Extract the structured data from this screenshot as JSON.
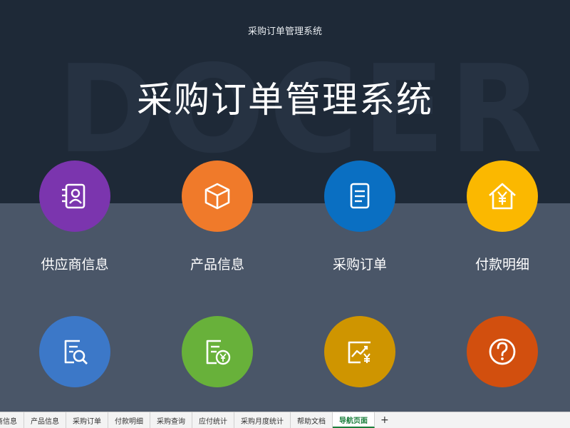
{
  "header": {
    "small_title": "采购订单管理系统",
    "title": "采购订单管理系统",
    "watermark": "DOCER"
  },
  "nav_items": [
    {
      "label": "供应商信息",
      "icon": "contact-card-icon",
      "color": "#7b35ae"
    },
    {
      "label": "产品信息",
      "icon": "box-icon",
      "color": "#f07a2a"
    },
    {
      "label": "采购订单",
      "icon": "document-icon",
      "color": "#0a6fc2"
    },
    {
      "label": "付款明细",
      "icon": "house-yen-icon",
      "color": "#fbb800"
    },
    {
      "label": "",
      "icon": "search-document-icon",
      "color": "#3c78c8"
    },
    {
      "label": "",
      "icon": "yen-document-icon",
      "color": "#68b13a"
    },
    {
      "label": "",
      "icon": "chart-yen-icon",
      "color": "#cf9500"
    },
    {
      "label": "",
      "icon": "question-icon",
      "color": "#d24f0e"
    }
  ],
  "sheet_tabs": [
    {
      "label": "商信息",
      "active": false
    },
    {
      "label": "产品信息",
      "active": false
    },
    {
      "label": "采购订单",
      "active": false
    },
    {
      "label": "付款明细",
      "active": false
    },
    {
      "label": "采购查询",
      "active": false
    },
    {
      "label": "应付统计",
      "active": false
    },
    {
      "label": "采购月度统计",
      "active": false
    },
    {
      "label": "帮助文档",
      "active": false
    },
    {
      "label": "导航页面",
      "active": true
    }
  ],
  "add_sheet": "+"
}
